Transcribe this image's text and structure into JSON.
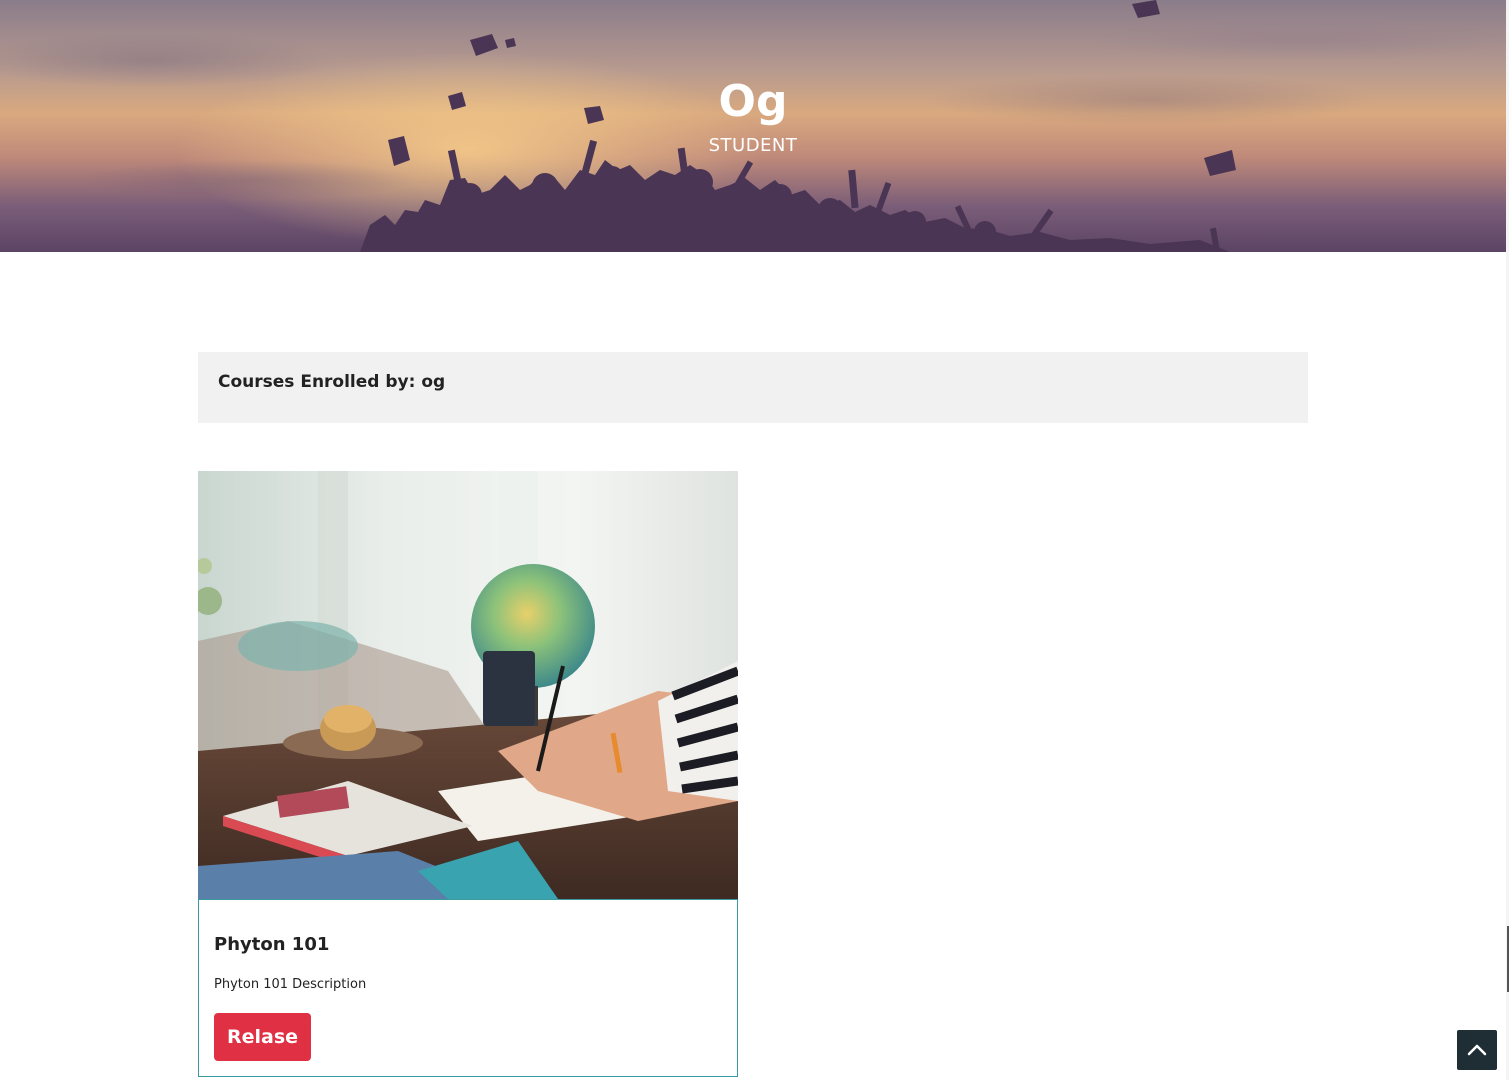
{
  "hero": {
    "title": "Og",
    "subtitle": "STUDENT"
  },
  "courses_section": {
    "header_title": "Courses Enrolled by: og"
  },
  "courses": [
    {
      "title": "Phyton 101",
      "description": "Phyton 101 Description",
      "action_label": "Relase"
    }
  ],
  "icons": {
    "scroll_top": "chevron-up-icon"
  },
  "colors": {
    "accent_red": "#e03044",
    "card_border": "#3b9aa0",
    "header_bg": "#f1f1f1",
    "scroll_button_bg": "#1f2d35"
  }
}
